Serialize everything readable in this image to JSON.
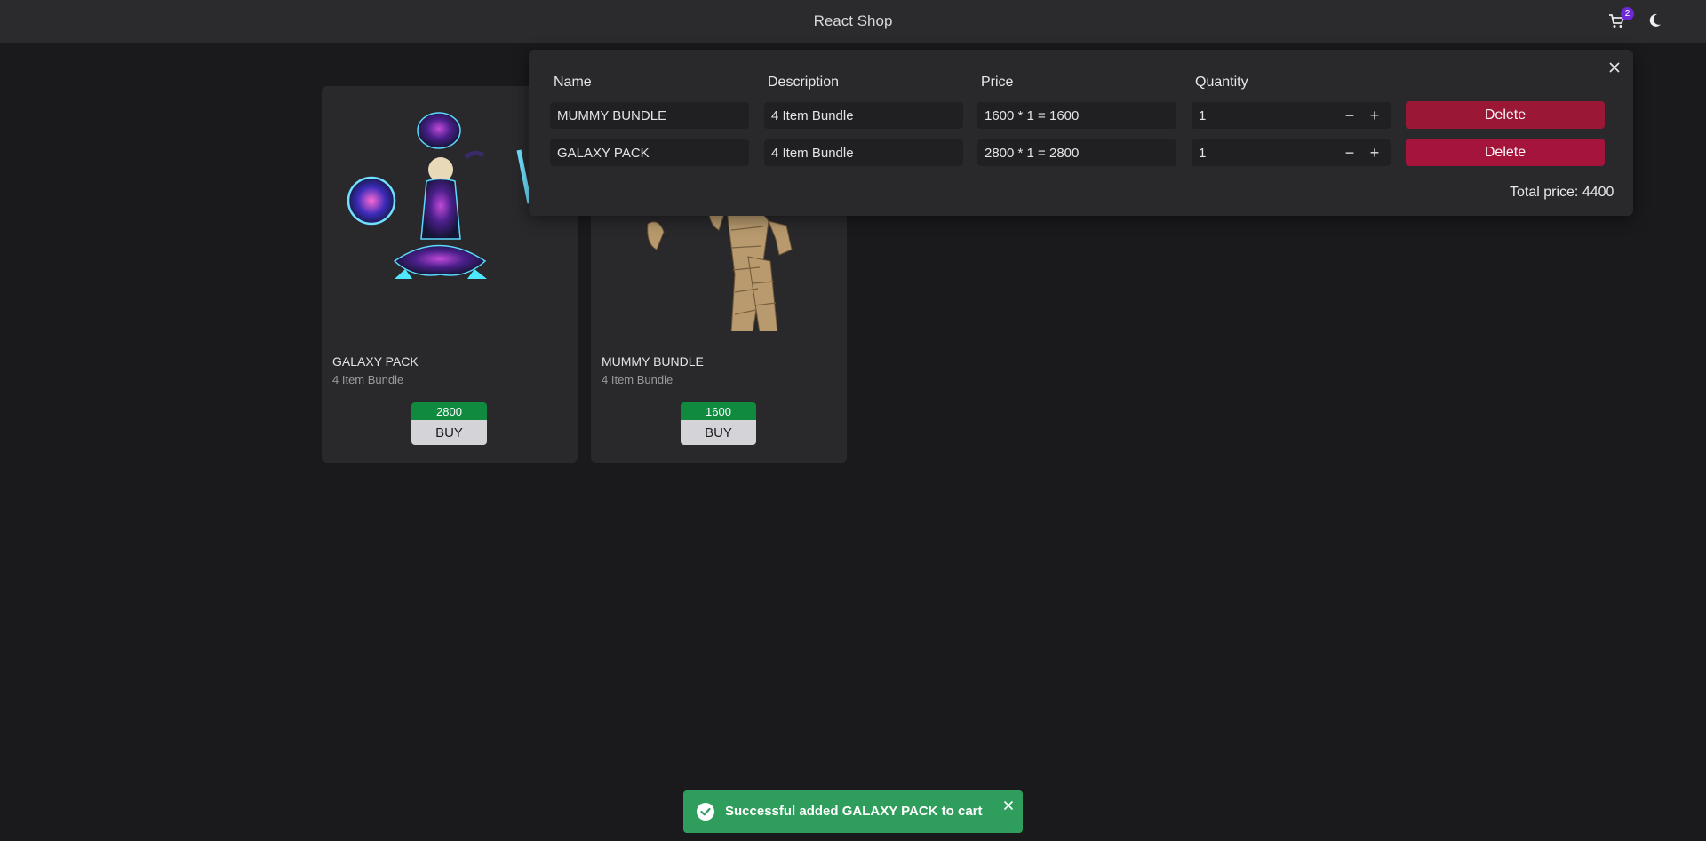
{
  "header": {
    "title": "React Shop",
    "cart_count": "2"
  },
  "products": [
    {
      "name": "GALAXY PACK",
      "description": "4 Item Bundle",
      "price": "2800",
      "buy_label": "BUY"
    },
    {
      "name": "MUMMY BUNDLE",
      "description": "4 Item Bundle",
      "price": "1600",
      "buy_label": "BUY"
    }
  ],
  "cart": {
    "columns": {
      "name": "Name",
      "description": "Description",
      "price": "Price",
      "quantity": "Quantity"
    },
    "items": [
      {
        "name": "MUMMY BUNDLE",
        "description": "4 Item Bundle",
        "price": "1600 * 1 = 1600",
        "quantity": "1",
        "minus": "−",
        "plus": "+",
        "delete_label": "Delete"
      },
      {
        "name": "GALAXY PACK",
        "description": "4 Item Bundle",
        "price": "2800 * 1 = 2800",
        "quantity": "1",
        "minus": "−",
        "plus": "+",
        "delete_label": "Delete"
      }
    ],
    "total": "Total price: 4400"
  },
  "toast": {
    "message": "Successful added GALAXY PACK to cart"
  },
  "colors": {
    "background": "#1a1a1d",
    "surface": "#29292c",
    "price_green": "#0f8a3e",
    "delete_red": "#9b1736",
    "toast_green": "#2f9e5d",
    "badge_purple": "#6d28d9"
  },
  "icons": [
    "cart-icon",
    "moon-icon",
    "close-icon",
    "minus-icon",
    "plus-icon",
    "check-circle-icon"
  ]
}
